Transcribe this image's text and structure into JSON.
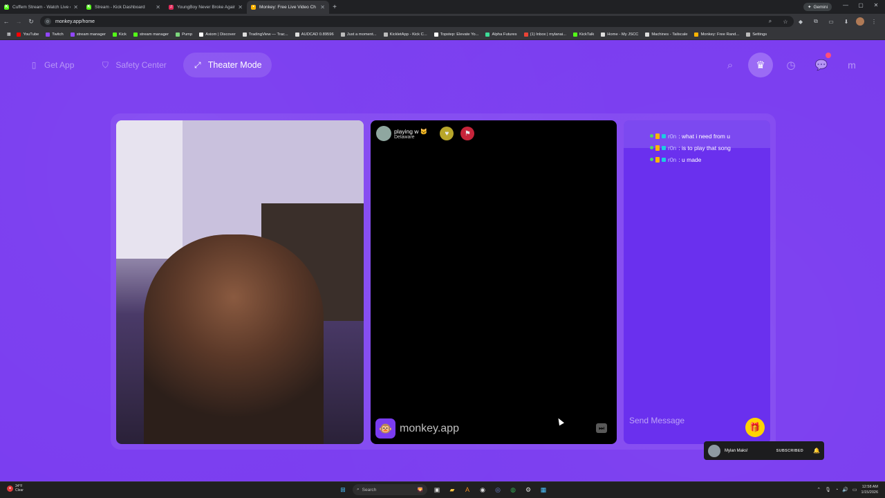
{
  "browser": {
    "tabs": [
      {
        "title": "Cuffem Stream - Watch Live on",
        "color": "#53fc18",
        "glyph": "K",
        "active": false
      },
      {
        "title": "Stream - Kick Dashboard",
        "color": "#53fc18",
        "glyph": "K",
        "active": false
      },
      {
        "title": "YoungBoy Never Broke Again -",
        "color": "#e32b5b",
        "glyph": "♫",
        "active": false
      },
      {
        "title": "Monkey: Free Live Video Ch",
        "color": "#ffb400",
        "glyph": "•",
        "active": true
      }
    ],
    "new_tab": "+",
    "gemini_label": "Gemini",
    "url": "monkey.app/home",
    "bookmarks": [
      {
        "label": "YouTube",
        "color": "#ff0000"
      },
      {
        "label": "Twitch",
        "color": "#9146ff"
      },
      {
        "label": "stream manager",
        "color": "#9146ff"
      },
      {
        "label": "Kick",
        "color": "#53fc18"
      },
      {
        "label": "stream manager",
        "color": "#53fc18"
      },
      {
        "label": "Pump",
        "color": "#7cd67c"
      },
      {
        "label": "Axiom | Discover",
        "color": "#ffffff"
      },
      {
        "label": "TradingView — Trac...",
        "color": "#dddddd"
      },
      {
        "label": "AUDCAD 0.89596",
        "color": "#dddddd"
      },
      {
        "label": "Just a moment...",
        "color": "#bbbbbb"
      },
      {
        "label": "KickletApp - Kick C...",
        "color": "#bbbbbb"
      },
      {
        "label": "Topstep: Elevate Yo...",
        "color": "#ffffff"
      },
      {
        "label": "Alpha Futures",
        "color": "#3ddc97"
      },
      {
        "label": "(1) Inbox | mylanai...",
        "color": "#ea4335"
      },
      {
        "label": "KickTalk",
        "color": "#53fc18"
      },
      {
        "label": "Home - My JSCC",
        "color": "#dddddd"
      },
      {
        "label": "Machines - Tailscale",
        "color": "#dddddd"
      },
      {
        "label": "Monkey: Free Rand...",
        "color": "#ffb400"
      },
      {
        "label": "Settings",
        "color": "#bbbbbb"
      }
    ]
  },
  "app": {
    "nav": {
      "get_app": "Get App",
      "safety_center": "Safety Center",
      "theater_mode": "Theater Mode"
    },
    "partner": {
      "username": "playing w 🐱",
      "location": "Delaware",
      "brand": "monkey.app"
    },
    "chat": {
      "messages": [
        {
          "user": "r0n",
          "text": ": what i need from u"
        },
        {
          "user": "r0n",
          "text": ": is to play that song"
        },
        {
          "user": "r0n",
          "text": ": u made"
        }
      ],
      "send_placeholder": "Send Message"
    },
    "toast": {
      "name": "Mylan Maks!",
      "status": "SUBSCRIBED"
    }
  },
  "taskbar": {
    "weather_temp": "34°F",
    "weather_cond": "Clear",
    "search": "Search",
    "time": "12:58 AM",
    "date": "1/15/2026"
  }
}
